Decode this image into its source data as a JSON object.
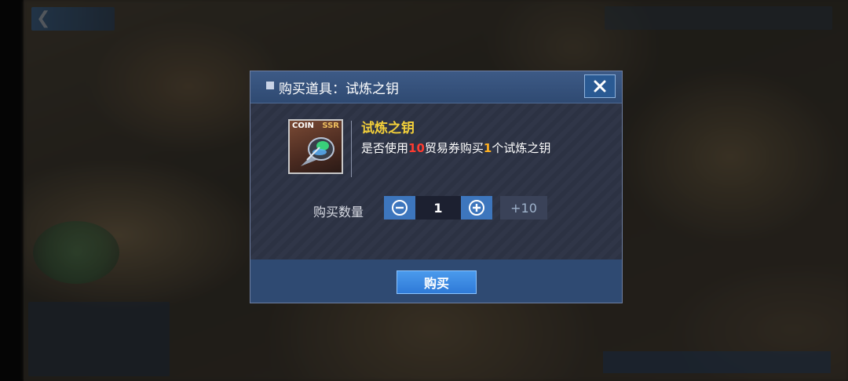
{
  "dialog": {
    "title": "购买道具：试炼之钥",
    "close_icon": "close-icon"
  },
  "item": {
    "badge_coin": "COIN",
    "badge_rarity": "SSR",
    "name": "试炼之钥",
    "desc_prefix": "是否使用",
    "desc_cost": "10",
    "desc_mid": "贸易券购买",
    "desc_count": "1",
    "desc_suffix": "个试炼之钥"
  },
  "quantity": {
    "label": "购买数量",
    "value": "1",
    "plus10_label": "+10",
    "minus_icon": "minus-circle-icon",
    "plus_icon": "plus-circle-icon"
  },
  "footer": {
    "buy_label": "购买"
  },
  "colors": {
    "item_name": "#f2cf3a",
    "cost_highlight": "#ff3b30",
    "count_highlight": "#ffb020",
    "button_blue": "#3d76bd"
  }
}
